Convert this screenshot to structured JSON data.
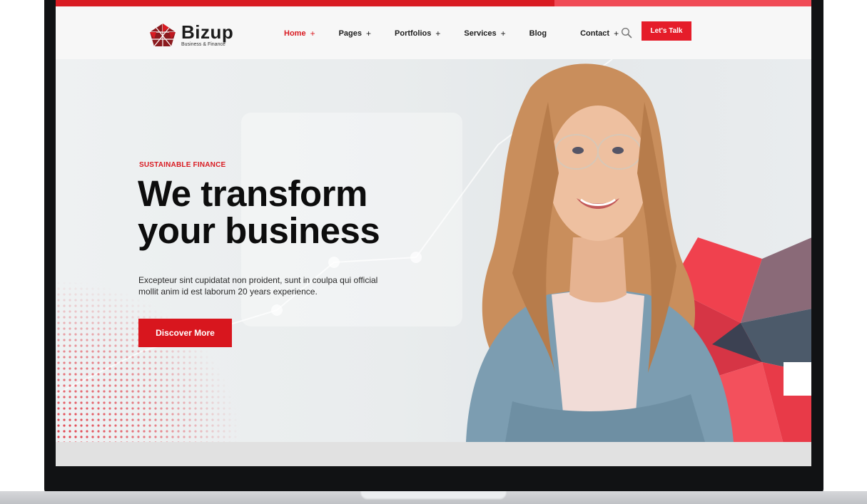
{
  "brand": {
    "name": "Bizup",
    "tagline": "Business & Finance"
  },
  "nav": {
    "items": [
      {
        "label": "Home",
        "plus": "+"
      },
      {
        "label": "Pages",
        "plus": "+"
      },
      {
        "label": "Portfolios",
        "plus": "+"
      },
      {
        "label": "Services",
        "plus": "+"
      },
      {
        "label": "Blog",
        "plus": ""
      },
      {
        "label": "Contact",
        "plus": "+"
      }
    ],
    "active_index": 0,
    "cta_label": "Let's Talk"
  },
  "hero": {
    "eyebrow": "SUSTAINABLE FINANCE",
    "title_line1": "We transform",
    "title_line2": "your business",
    "description": "Excepteur sint cupidatat non proident, sunt in coulpa qui official mollit anim id est laborum 20 years experience.",
    "button_label": "Discover More"
  },
  "colors": {
    "accent": "#d91b22",
    "dark": "#0d0d0d",
    "frame": "#111214"
  },
  "icons": [
    "bizup-logo-icon",
    "search-icon"
  ]
}
